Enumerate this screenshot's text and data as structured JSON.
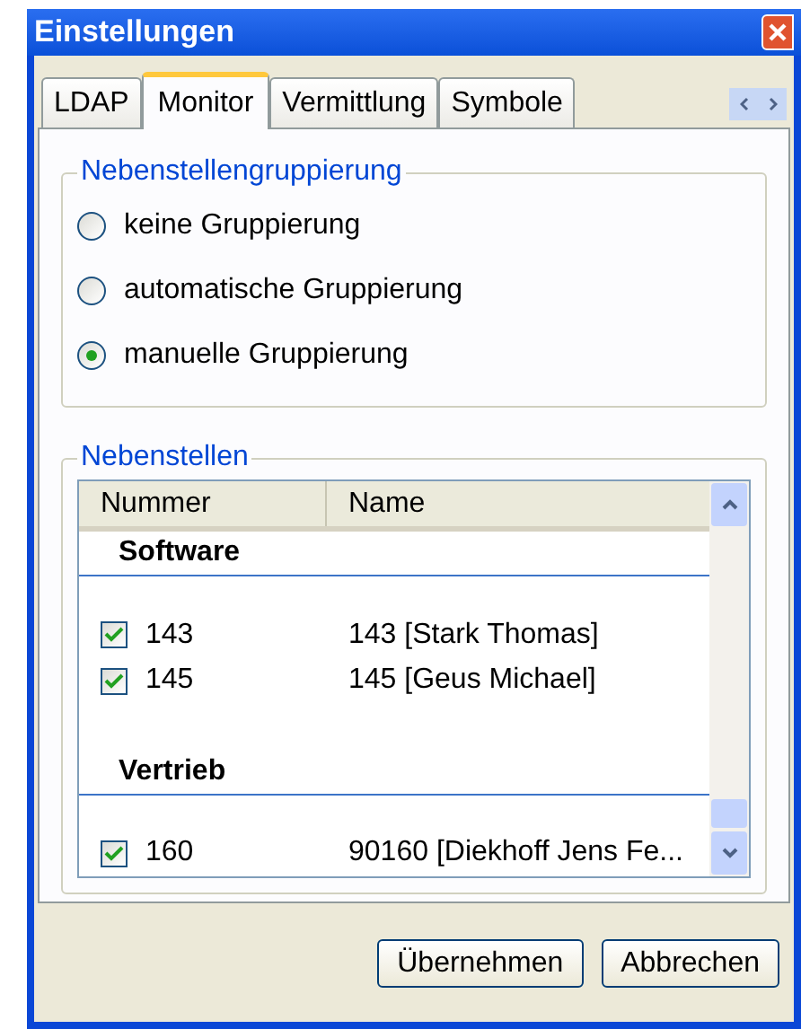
{
  "window": {
    "title": "Einstellungen"
  },
  "tabs": [
    {
      "label": "LDAP",
      "selected": false
    },
    {
      "label": "Monitor",
      "selected": true
    },
    {
      "label": "Vermittlung",
      "selected": false
    },
    {
      "label": "Symbole",
      "selected": false
    }
  ],
  "grouping": {
    "legend": "Nebenstellengruppierung",
    "options": [
      {
        "label": "keine Gruppierung",
        "selected": false
      },
      {
        "label": "automatische Gruppierung",
        "selected": false
      },
      {
        "label": "manuelle Gruppierung",
        "selected": true
      }
    ]
  },
  "extensions": {
    "legend": "Nebenstellen",
    "columns": [
      "Nummer",
      "Name"
    ],
    "rows": [
      {
        "kind": "group",
        "label": "Software"
      },
      {
        "kind": "item",
        "number": "143",
        "name": "143 [Stark Thomas]",
        "checked": true
      },
      {
        "kind": "item",
        "number": "145",
        "name": "145 [Geus Michael]",
        "checked": true
      },
      {
        "kind": "group",
        "label": "Vertrieb"
      },
      {
        "kind": "item",
        "number": "160",
        "name": "90160 [Diekhoff Jens Fe...",
        "checked": true
      }
    ]
  },
  "buttons": [
    "Übernehmen",
    "Abbrechen"
  ]
}
